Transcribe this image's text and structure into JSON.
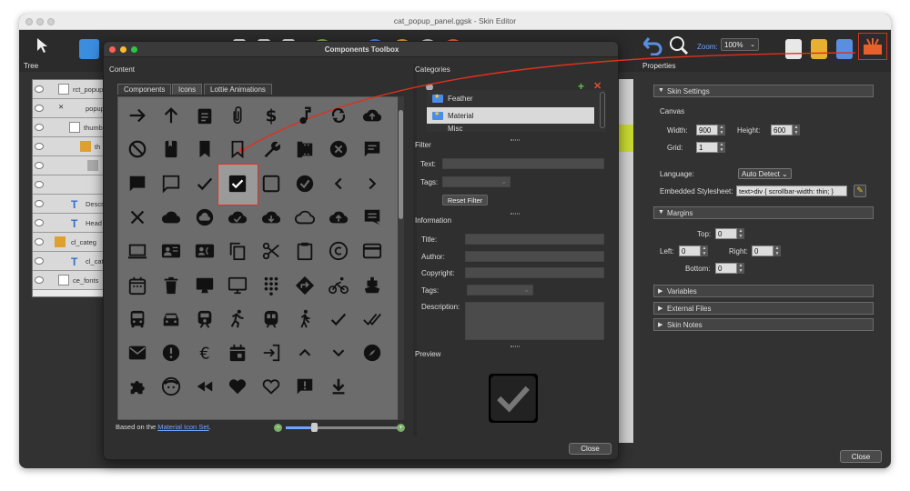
{
  "window": {
    "title": "cat_popup_panel.ggsk - Skin Editor"
  },
  "toolbar": {
    "zoom_label": "Zoom:",
    "zoom_value": "100%"
  },
  "tree": {
    "label": "Tree",
    "rows": [
      {
        "label": "rct_popup"
      },
      {
        "label": "popup"
      },
      {
        "label": "thumb"
      },
      {
        "label": "th"
      },
      {
        "label": ""
      },
      {
        "label": ""
      },
      {
        "label": "Descr"
      },
      {
        "label": "Head"
      },
      {
        "label": "cl_categ"
      },
      {
        "label": "cl_cat"
      },
      {
        "label": "ce_fonts"
      }
    ]
  },
  "dialog": {
    "title": "Components Toolbox",
    "content_label": "Content",
    "tabs": [
      "Components",
      "Icons",
      "Lottie Animations"
    ],
    "active_tab": "Icons",
    "icons": [
      "arrow-forward-icon",
      "arrow-upward-icon",
      "assignment-icon",
      "attach-file-icon",
      "dollar-icon",
      "audiotrack-icon",
      "autorenew-icon",
      "backup-icon",
      "block-icon",
      "book-icon",
      "bookmark-icon",
      "bookmark-border-icon",
      "build-icon",
      "camera-roll-icon",
      "cancel-icon",
      "chat-icon",
      "chat-bubble-icon",
      "chat-bubble-outline-icon",
      "check-icon",
      "check-box-icon",
      "check-box-outline-blank-icon",
      "check-circle-icon",
      "chevron-left-icon",
      "chevron-right-icon",
      "clear-icon",
      "cloud-icon",
      "cloud-circle-icon",
      "cloud-done-icon",
      "cloud-download-icon",
      "cloud-queue-icon",
      "cloud-upload-icon",
      "comment-icon",
      "computer-icon",
      "contact-mail-icon",
      "contact-phone-icon",
      "content-copy-icon",
      "content-cut-icon",
      "content-paste-icon",
      "copyright-icon",
      "credit-card-icon",
      "date-range-icon",
      "delete-icon",
      "desktop-mac-icon",
      "desktop-windows-icon",
      "dialpad-icon",
      "directions-icon",
      "directions-bike-icon",
      "directions-boat-icon",
      "directions-bus-icon",
      "directions-car-icon",
      "directions-railway-icon",
      "directions-run-icon",
      "directions-subway-icon",
      "directions-walk-icon",
      "done-icon",
      "done-all-icon",
      "email-icon",
      "error-icon",
      "euro-symbol-icon",
      "event-icon",
      "exit-to-app-icon",
      "expand-less-icon",
      "expand-more-icon",
      "explore-icon",
      "extension-icon",
      "face-icon",
      "fast-rewind-icon",
      "favorite-icon",
      "favorite-border-icon",
      "feedback-icon",
      "file-download-icon"
    ],
    "based_on_prefix": "Based on the ",
    "based_on_link": "Material Icon Set",
    "based_on_suffix": ".",
    "categories_label": "Categories",
    "categories": [
      "Feather",
      "Material",
      "Misc"
    ],
    "selected_category": "Material",
    "filter": {
      "label": "Filter",
      "text_label": "Text:",
      "text_value": "",
      "tags_label": "Tags:",
      "reset_button": "Reset Filter"
    },
    "information": {
      "label": "Information",
      "title": "Title:",
      "author": "Author:",
      "copyright": "Copyright:",
      "tags": "Tags:",
      "description": "Description:"
    },
    "preview_label": "Preview",
    "close_button": "Close"
  },
  "properties": {
    "label": "Properties",
    "skin_settings": "Skin Settings",
    "canvas": "Canvas",
    "width_label": "Width:",
    "width_value": "900",
    "height_label": "Height:",
    "height_value": "600",
    "grid_label": "Grid:",
    "grid_value": "1",
    "language_label": "Language:",
    "language_value": "Auto Detect",
    "stylesheet_label": "Embedded Stylesheet:",
    "stylesheet_value": "text>div {  scrollbar-width: thin; }",
    "margins": "Margins",
    "top_label": "Top:",
    "top_value": "0",
    "left_label": "Left:",
    "left_value": "0",
    "right_label": "Right:",
    "right_value": "0",
    "bottom_label": "Bottom:",
    "bottom_value": "0",
    "variables": "Variables",
    "external_files": "External Files",
    "skin_notes": "Skin Notes",
    "close_button": "Close"
  },
  "colors": {
    "accent": "#6fa4ff",
    "highlight": "#e0301e",
    "panel_bg": "#323232"
  }
}
